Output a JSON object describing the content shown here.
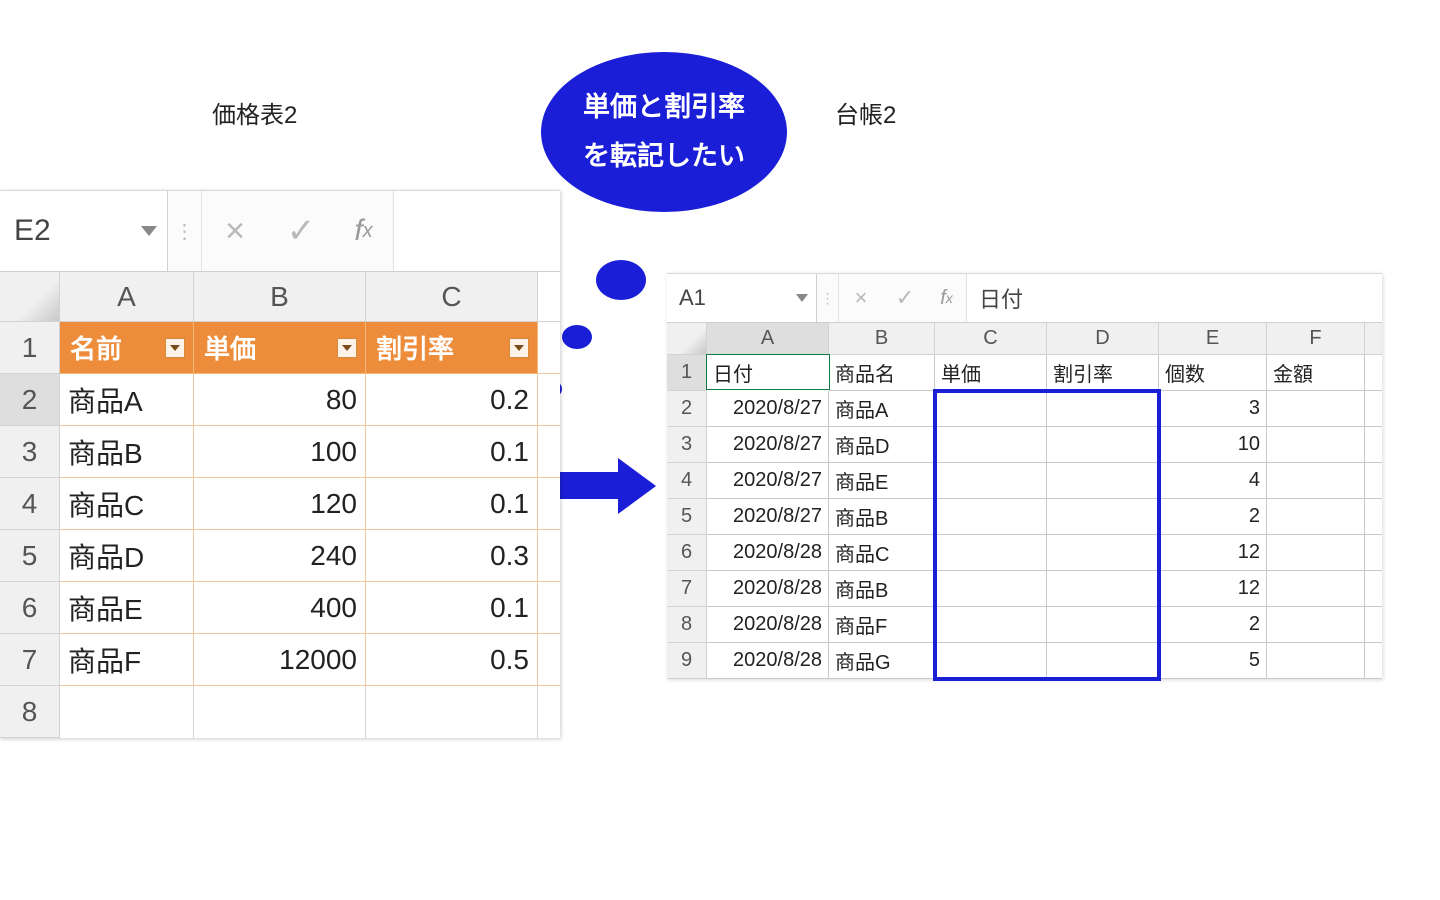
{
  "labels": {
    "left_title": "価格表2",
    "right_title": "台帳2",
    "bubble_line1": "単価と割引率",
    "bubble_line2": "を転記したい"
  },
  "left_excel": {
    "namebox": "E2",
    "fx_value": "",
    "col_headers": [
      "A",
      "B",
      "C"
    ],
    "row_headers": [
      "1",
      "2",
      "3",
      "4",
      "5",
      "6",
      "7",
      "8"
    ],
    "header_row": {
      "name": "名前",
      "price": "単価",
      "discount": "割引率"
    },
    "rows": [
      {
        "name": "商品A",
        "price": "80",
        "discount": "0.2"
      },
      {
        "name": "商品B",
        "price": "100",
        "discount": "0.1"
      },
      {
        "name": "商品C",
        "price": "120",
        "discount": "0.1"
      },
      {
        "name": "商品D",
        "price": "240",
        "discount": "0.3"
      },
      {
        "name": "商品E",
        "price": "400",
        "discount": "0.1"
      },
      {
        "name": "商品F",
        "price": "12000",
        "discount": "0.5"
      }
    ]
  },
  "right_excel": {
    "namebox": "A1",
    "fx_value": "日付",
    "col_headers": [
      "A",
      "B",
      "C",
      "D",
      "E",
      "F"
    ],
    "row_headers": [
      "1",
      "2",
      "3",
      "4",
      "5",
      "6",
      "7",
      "8",
      "9"
    ],
    "header_row": {
      "date": "日付",
      "product": "商品名",
      "price": "単価",
      "discount": "割引率",
      "qty": "個数",
      "amount": "金額"
    },
    "rows": [
      {
        "date": "2020/8/27",
        "product": "商品A",
        "price": "",
        "discount": "",
        "qty": "3",
        "amount": ""
      },
      {
        "date": "2020/8/27",
        "product": "商品D",
        "price": "",
        "discount": "",
        "qty": "10",
        "amount": ""
      },
      {
        "date": "2020/8/27",
        "product": "商品E",
        "price": "",
        "discount": "",
        "qty": "4",
        "amount": ""
      },
      {
        "date": "2020/8/27",
        "product": "商品B",
        "price": "",
        "discount": "",
        "qty": "2",
        "amount": ""
      },
      {
        "date": "2020/8/28",
        "product": "商品C",
        "price": "",
        "discount": "",
        "qty": "12",
        "amount": ""
      },
      {
        "date": "2020/8/28",
        "product": "商品B",
        "price": "",
        "discount": "",
        "qty": "12",
        "amount": ""
      },
      {
        "date": "2020/8/28",
        "product": "商品F",
        "price": "",
        "discount": "",
        "qty": "2",
        "amount": ""
      },
      {
        "date": "2020/8/28",
        "product": "商品G",
        "price": "",
        "discount": "",
        "qty": "5",
        "amount": ""
      }
    ]
  },
  "chart_data": [
    {
      "type": "table",
      "title": "価格表2",
      "columns": [
        "名前",
        "単価",
        "割引率"
      ],
      "rows": [
        [
          "商品A",
          80,
          0.2
        ],
        [
          "商品B",
          100,
          0.1
        ],
        [
          "商品C",
          120,
          0.1
        ],
        [
          "商品D",
          240,
          0.3
        ],
        [
          "商品E",
          400,
          0.1
        ],
        [
          "商品F",
          12000,
          0.5
        ]
      ]
    },
    {
      "type": "table",
      "title": "台帳2",
      "columns": [
        "日付",
        "商品名",
        "単価",
        "割引率",
        "個数",
        "金額"
      ],
      "rows": [
        [
          "2020/8/27",
          "商品A",
          null,
          null,
          3,
          null
        ],
        [
          "2020/8/27",
          "商品D",
          null,
          null,
          10,
          null
        ],
        [
          "2020/8/27",
          "商品E",
          null,
          null,
          4,
          null
        ],
        [
          "2020/8/27",
          "商品B",
          null,
          null,
          2,
          null
        ],
        [
          "2020/8/28",
          "商品C",
          null,
          null,
          12,
          null
        ],
        [
          "2020/8/28",
          "商品B",
          null,
          null,
          12,
          null
        ],
        [
          "2020/8/28",
          "商品F",
          null,
          null,
          2,
          null
        ],
        [
          "2020/8/28",
          "商品G",
          null,
          null,
          5,
          null
        ]
      ]
    }
  ]
}
